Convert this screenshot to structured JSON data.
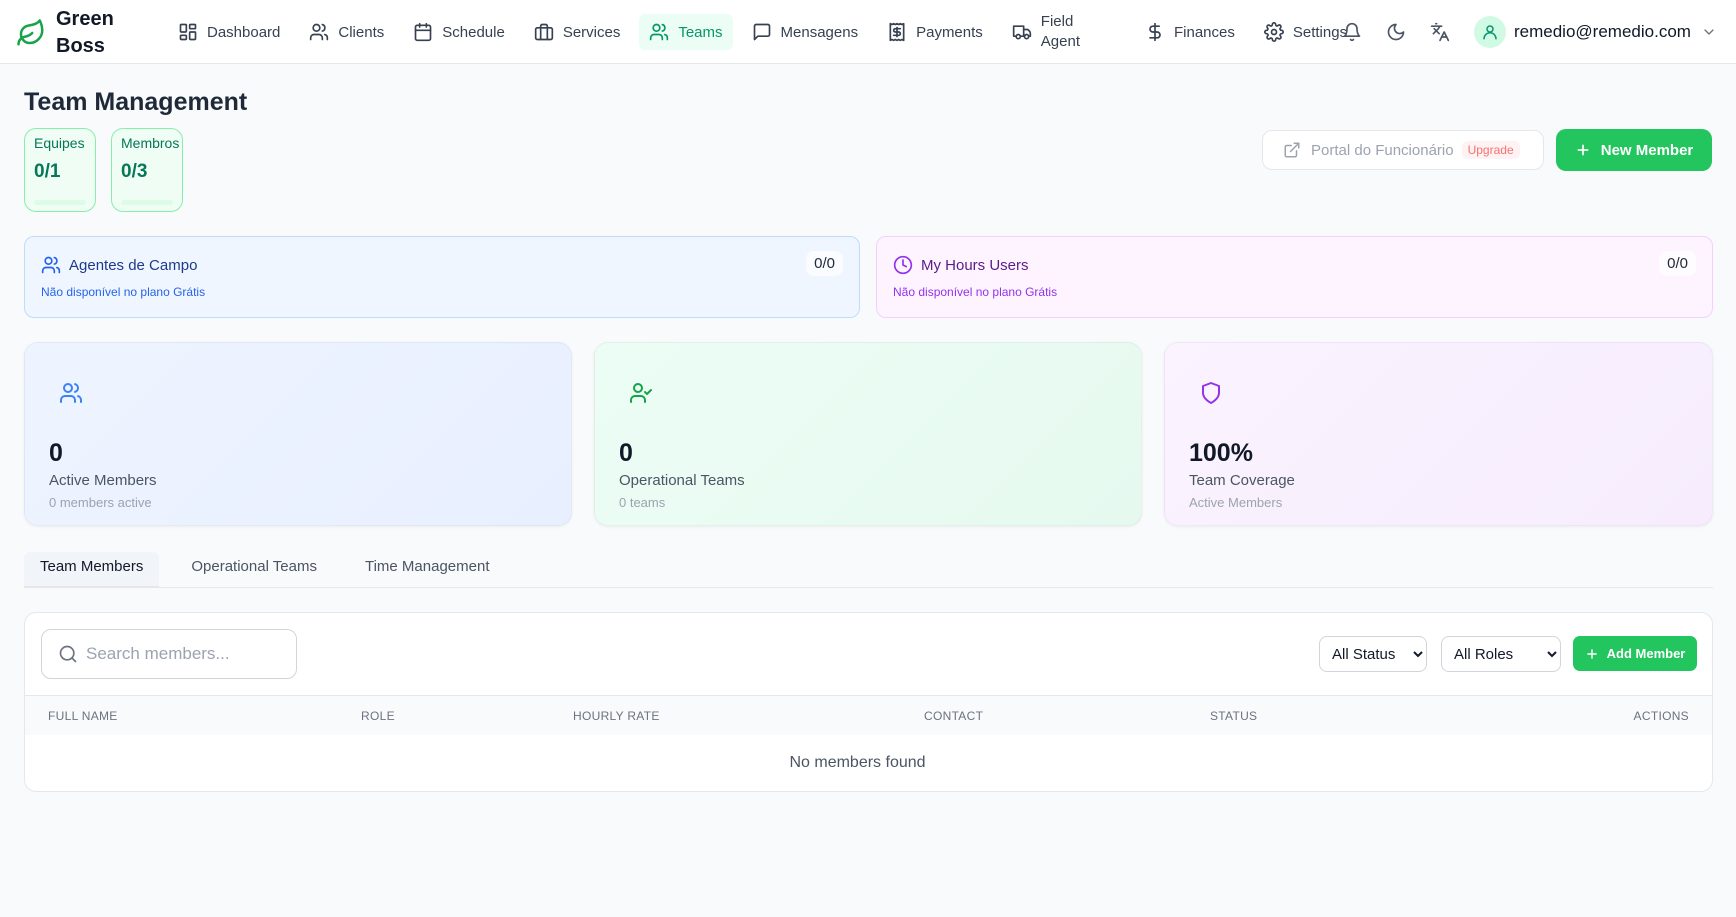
{
  "brand": {
    "line1": "Green",
    "line2": "Boss"
  },
  "nav": {
    "items": [
      {
        "label": "Dashboard",
        "icon": "dashboard-icon"
      },
      {
        "label": "Clients",
        "icon": "users-icon"
      },
      {
        "label": "Schedule",
        "icon": "calendar-icon"
      },
      {
        "label": "Services",
        "icon": "briefcase-icon"
      },
      {
        "label": "Teams",
        "icon": "users-icon",
        "active": true
      },
      {
        "label": "Mensagens",
        "icon": "message-icon"
      },
      {
        "label": "Payments",
        "icon": "receipt-icon"
      },
      {
        "label_line1": "Field",
        "label_line2": "Agent",
        "icon": "truck-icon"
      },
      {
        "label": "Finances",
        "icon": "dollar-icon"
      },
      {
        "label": "Settings",
        "icon": "gear-icon"
      }
    ],
    "user_email": "remedio@remedio.com"
  },
  "header": {
    "title": "Team Management",
    "quotas": [
      {
        "label": "Equipes",
        "value": "0/1",
        "fraction": 0
      },
      {
        "label": "Membros",
        "value": "0/3",
        "fraction": 0
      }
    ],
    "portal_button": "Portal do Funcionário",
    "upgrade_badge": "Upgrade",
    "new_member_button": "New Member"
  },
  "plan_cards": [
    {
      "title": "Agentes de Campo",
      "count": "0/0",
      "subtitle": "Não disponível no plano Grátis",
      "accent": "#2563eb"
    },
    {
      "title": "My Hours Users",
      "count": "0/0",
      "subtitle": "Não disponível no plano Grátis",
      "accent": "#9333ea"
    }
  ],
  "stats": [
    {
      "value": "0",
      "label": "Active Members",
      "sub": "0 members active",
      "icon": "users-icon",
      "color": "#3b82f6"
    },
    {
      "value": "0",
      "label": "Operational Teams",
      "sub": "0 teams",
      "icon": "user-check-icon",
      "color": "#16a34a"
    },
    {
      "value": "100%",
      "label": "Team Coverage",
      "sub": "Active Members",
      "icon": "shield-icon",
      "color": "#9333ea"
    }
  ],
  "tabs": [
    {
      "label": "Team Members",
      "active": true
    },
    {
      "label": "Operational Teams"
    },
    {
      "label": "Time Management"
    }
  ],
  "table": {
    "search_placeholder": "Search members...",
    "status_filter": "All Status",
    "roles_filter": "All Roles",
    "add_member_button": "Add Member",
    "columns": [
      "Full Name",
      "Role",
      "Hourly Rate",
      "Contact",
      "Status",
      "Actions"
    ],
    "empty_message": "No members found"
  },
  "colors": {
    "primary": "#22c55e",
    "active_nav": "#059669"
  }
}
